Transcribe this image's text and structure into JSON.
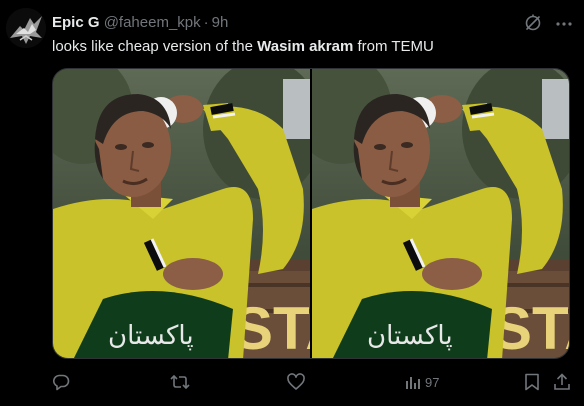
{
  "tweet": {
    "author_name": "Epic G",
    "handle": "@faheem_kpk",
    "separator": "·",
    "time": "9h",
    "text_before": "looks like cheap version of the ",
    "text_bold": "Wasim akram",
    "text_after": " from TEMU",
    "photos": [
      {
        "sign_text": "STA",
        "jersey_text": "پاکستان"
      },
      {
        "sign_text": "STA",
        "jersey_text": "پاکستان"
      }
    ],
    "views": "97"
  },
  "colors": {
    "background": "#000000",
    "text": "#e7e9ea",
    "muted": "#71767b",
    "jersey": "#c9c22a",
    "jersey_dark": "#0f3d1c"
  },
  "icons": [
    "grok-icon",
    "more-icon",
    "reply-icon",
    "retweet-icon",
    "like-icon",
    "views-icon",
    "bookmark-icon",
    "share-icon"
  ]
}
